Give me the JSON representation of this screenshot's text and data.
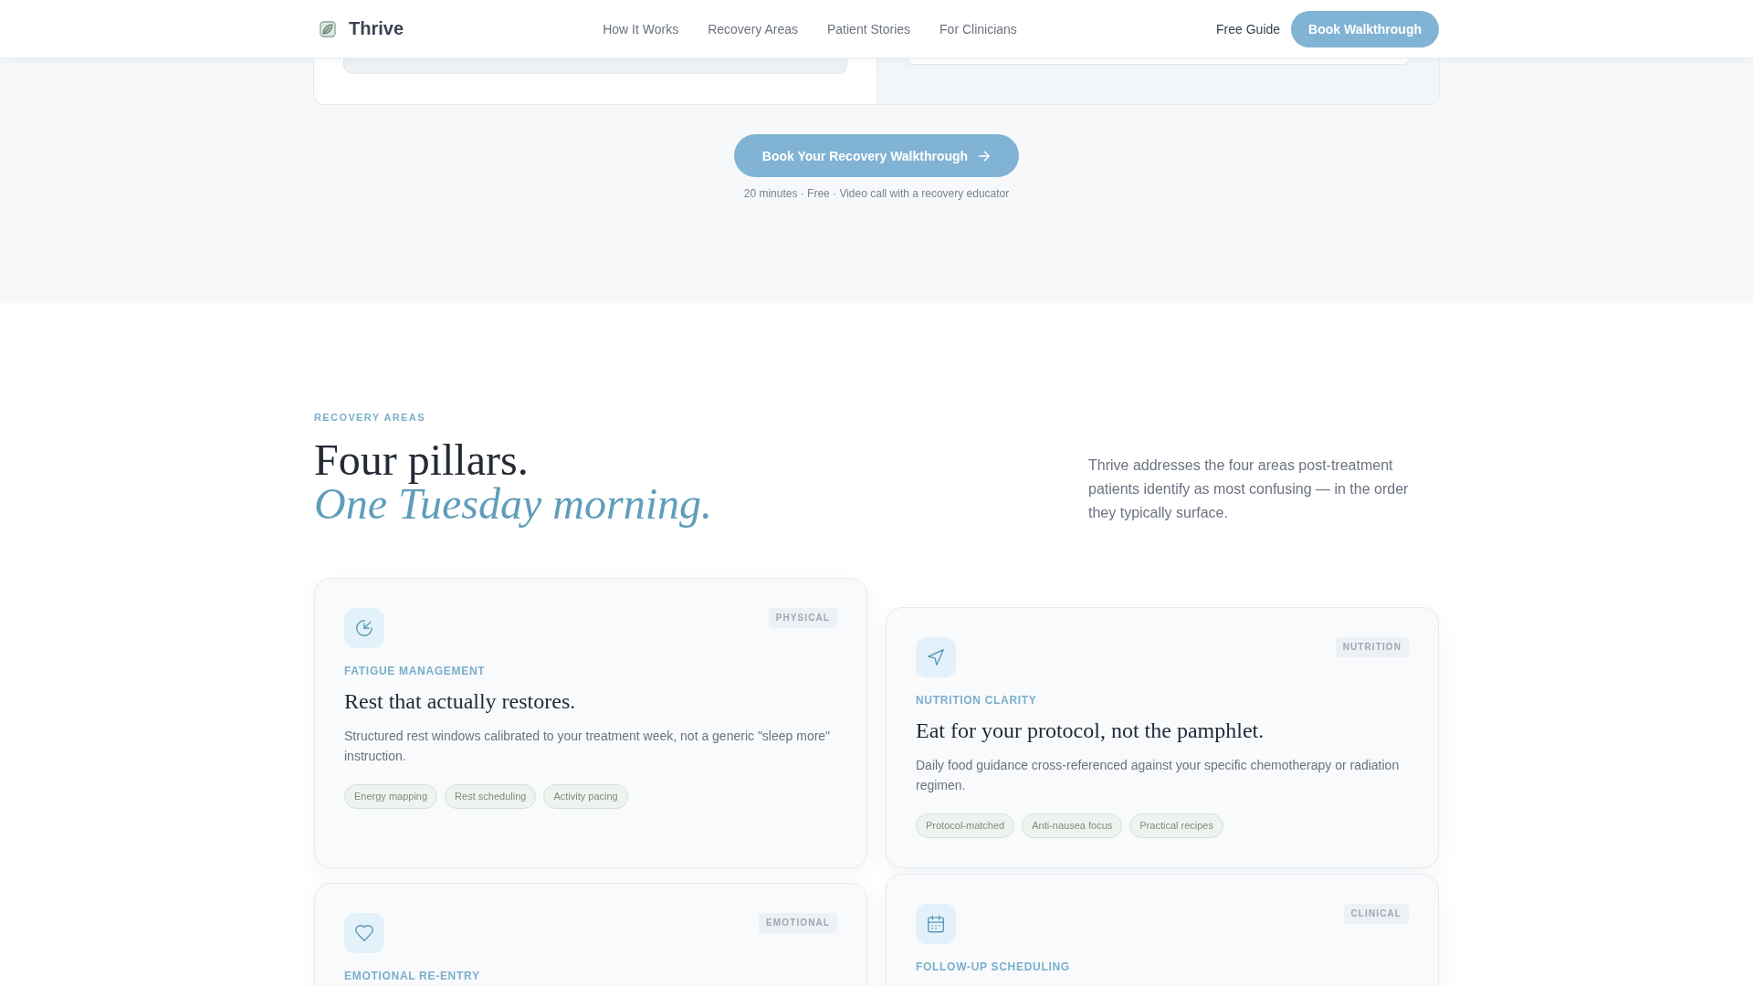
{
  "header": {
    "brand": "Thrive",
    "nav": [
      "How It Works",
      "Recovery Areas",
      "Patient Stories",
      "For Clinicians"
    ],
    "guide_link": "Free Guide",
    "cta": "Book Walkthrough"
  },
  "walkthrough": {
    "button": "Book Your Recovery Walkthrough",
    "caption": "20 minutes · Free · Video call with a recovery educator"
  },
  "recovery_areas": {
    "eyebrow": "RECOVERY AREAS",
    "title": "Four pillars.",
    "title_accent": "One Tuesday morning.",
    "intro": "Thrive addresses the four areas post-treatment patients identify as most confusing — in the order they typically surface.",
    "cards": [
      {
        "badge": "PHYSICAL",
        "label": "FATIGUE MANAGEMENT",
        "title": "Rest that actually restores.",
        "description": "Structured rest windows calibrated to your treatment week, not a generic \"sleep more\" instruction.",
        "tags": [
          "Energy mapping",
          "Rest scheduling",
          "Activity pacing"
        ]
      },
      {
        "badge": "NUTRITION",
        "label": "NUTRITION CLARITY",
        "title": "Eat for your protocol, not the pamphlet.",
        "description": "Daily food guidance cross-referenced against your specific chemotherapy or radiation regimen.",
        "tags": [
          "Protocol-matched",
          "Anti-nausea focus",
          "Practical recipes"
        ]
      },
      {
        "badge": "EMOTIONAL",
        "label": "EMOTIONAL RE-ENTRY"
      },
      {
        "badge": "CLINICAL",
        "label": "FOLLOW-UP SCHEDULING"
      }
    ]
  }
}
